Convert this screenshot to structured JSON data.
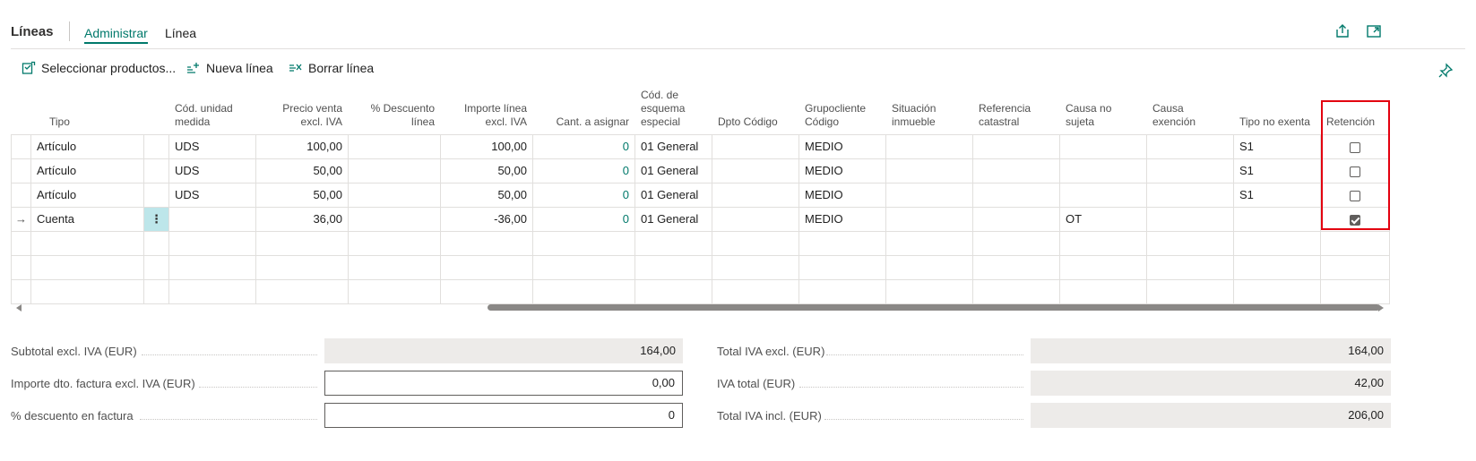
{
  "header": {
    "title": "Líneas",
    "tabs": [
      {
        "label": "Administrar",
        "active": true
      },
      {
        "label": "Línea",
        "active": false
      }
    ]
  },
  "actions": {
    "select_products": "Seleccionar productos...",
    "new_line": "Nueva línea",
    "delete_line": "Borrar línea"
  },
  "table": {
    "headers": {
      "tipo": "Tipo",
      "unidad": "Cód. unidad medida",
      "precio": "Precio venta excl. IVA",
      "descuento": "% Descuento línea",
      "importe": "Importe línea excl. IVA",
      "cant": "Cant. a asignar",
      "esquema": "Cód. de esquema especial",
      "dpto": "Dpto Código",
      "grupo": "Grupocliente Código",
      "situacion": "Situación inmueble",
      "referencia": "Referencia catastral",
      "causa_no": "Causa no sujeta",
      "causa_ex": "Causa exención",
      "tipo_no": "Tipo no exenta",
      "retencion": "Retención"
    },
    "rows": [
      {
        "tipo": "Artículo",
        "unidad": "UDS",
        "precio": "100,00",
        "descuento": "",
        "importe": "100,00",
        "cant": "0",
        "esquema": "01 General",
        "dpto": "",
        "grupo": "MEDIO",
        "situacion": "",
        "referencia": "",
        "causa_no": "",
        "causa_ex": "",
        "tipo_no": "S1",
        "retencion": false
      },
      {
        "tipo": "Artículo",
        "unidad": "UDS",
        "precio": "50,00",
        "descuento": "",
        "importe": "50,00",
        "cant": "0",
        "esquema": "01 General",
        "dpto": "",
        "grupo": "MEDIO",
        "situacion": "",
        "referencia": "",
        "causa_no": "",
        "causa_ex": "",
        "tipo_no": "S1",
        "retencion": false
      },
      {
        "tipo": "Artículo",
        "unidad": "UDS",
        "precio": "50,00",
        "descuento": "",
        "importe": "50,00",
        "cant": "0",
        "esquema": "01 General",
        "dpto": "",
        "grupo": "MEDIO",
        "situacion": "",
        "referencia": "",
        "causa_no": "",
        "causa_ex": "",
        "tipo_no": "S1",
        "retencion": false
      },
      {
        "tipo": "Cuenta",
        "unidad": "",
        "precio": "36,00",
        "descuento": "",
        "importe": "-36,00",
        "cant": "0",
        "esquema": "01 General",
        "dpto": "",
        "grupo": "MEDIO",
        "situacion": "",
        "referencia": "",
        "causa_no": "OT",
        "causa_ex": "",
        "tipo_no": "",
        "retencion": true
      }
    ],
    "row_marker": "→",
    "row_menu": "⋮"
  },
  "totals": {
    "subtotal_label": "Subtotal excl. IVA (EUR)",
    "subtotal_value": "164,00",
    "dto_label": "Importe dto. factura excl. IVA (EUR)",
    "dto_value": "0,00",
    "pct_label": "% descuento en factura",
    "pct_value": "0",
    "total_excl_label": "Total IVA excl. (EUR)",
    "total_excl_value": "164,00",
    "iva_label": "IVA total (EUR)",
    "iva_value": "42,00",
    "total_incl_label": "Total IVA incl. (EUR)",
    "total_incl_value": "206,00"
  },
  "colors": {
    "accent": "#00796b",
    "highlight": "#e3000f",
    "selected_cell": "#bde6ea"
  }
}
